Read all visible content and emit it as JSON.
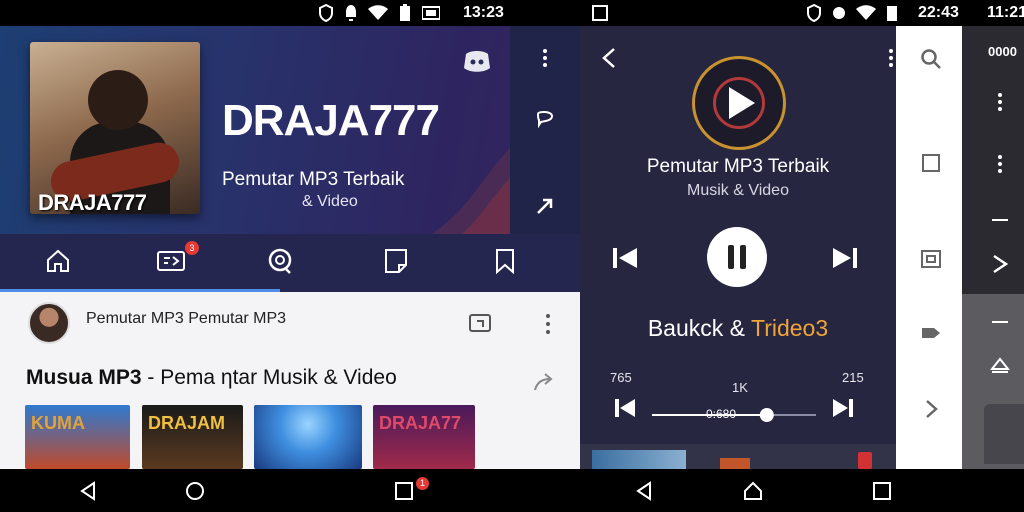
{
  "status_bar": {
    "time_left": "13:23",
    "time_mid": "22:43",
    "time_right": "11:21"
  },
  "banner": {
    "card_label": "DRAJA777",
    "title": "DRAJA777",
    "subtitle": "Pemutar MP3 Terbaik",
    "subtitle2": "& Video"
  },
  "tabs": [
    {
      "icon": "home-icon"
    },
    {
      "icon": "video-icon",
      "badge": "3"
    },
    {
      "icon": "chat-icon"
    },
    {
      "icon": "document-icon"
    },
    {
      "icon": "bookmark-icon"
    }
  ],
  "post": {
    "title": "Pemutar MP3 Pemutar MP3"
  },
  "section": {
    "title_bold": "Musua MP3",
    "title_rest": " - Pema ηtar Musik & Video"
  },
  "thumbnails": [
    {
      "label": "KUMA",
      "color": "#e0a43a"
    },
    {
      "label": "DRAJAM",
      "color": "#f0c040"
    },
    {
      "label": "",
      "color": "#3f8fe0"
    },
    {
      "label": "DRAJA77",
      "color": "#e04a6a"
    }
  ],
  "player": {
    "title": "Pemutar MP3 Terbaik",
    "subtitle": "Musik & Video",
    "track_white": "Bauk",
    "track_mid": "ck & ",
    "track_orange": "Trideo3",
    "time_elapsed": "765",
    "time_mid": "1K",
    "time_total": "215",
    "seek_label": "0:680",
    "progress": 0.7
  },
  "far_panel": {
    "label": "0000"
  },
  "nav_bar": {
    "badge": "1"
  },
  "colors": {
    "accent": "#4f8ee8",
    "player_bg": "#262640",
    "banner_bg": "#28326b",
    "highlight": "#f0a43a"
  }
}
